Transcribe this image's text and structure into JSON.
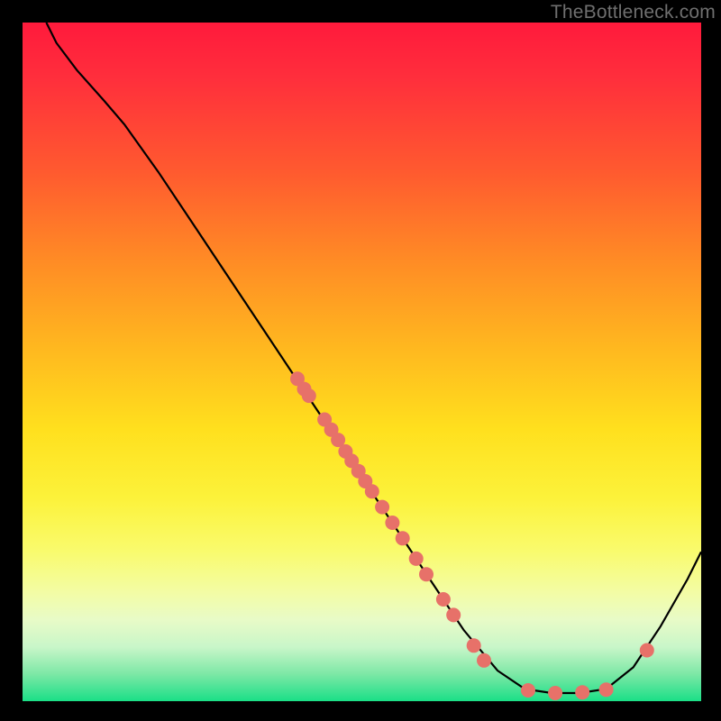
{
  "watermark": "TheBottleneck.com",
  "chart_data": {
    "type": "line",
    "title": "",
    "xlabel": "",
    "ylabel": "",
    "xlim": [
      0,
      100
    ],
    "ylim": [
      0,
      100
    ],
    "curve": [
      {
        "x": 3.5,
        "y": 100
      },
      {
        "x": 5,
        "y": 97
      },
      {
        "x": 8,
        "y": 93
      },
      {
        "x": 12,
        "y": 88.5
      },
      {
        "x": 15,
        "y": 85
      },
      {
        "x": 20,
        "y": 78
      },
      {
        "x": 25,
        "y": 70.5
      },
      {
        "x": 30,
        "y": 63
      },
      {
        "x": 35,
        "y": 55.5
      },
      {
        "x": 40,
        "y": 48
      },
      {
        "x": 45,
        "y": 40.5
      },
      {
        "x": 50,
        "y": 33
      },
      {
        "x": 55,
        "y": 25.5
      },
      {
        "x": 60,
        "y": 18
      },
      {
        "x": 65,
        "y": 10.5
      },
      {
        "x": 70,
        "y": 4.5
      },
      {
        "x": 74,
        "y": 1.8
      },
      {
        "x": 78,
        "y": 1.2
      },
      {
        "x": 82,
        "y": 1.2
      },
      {
        "x": 86,
        "y": 1.8
      },
      {
        "x": 90,
        "y": 5
      },
      {
        "x": 94,
        "y": 11
      },
      {
        "x": 98,
        "y": 18
      },
      {
        "x": 100,
        "y": 22
      }
    ],
    "markers": [
      {
        "x": 40.5,
        "y": 47.5
      },
      {
        "x": 41.5,
        "y": 46
      },
      {
        "x": 42.2,
        "y": 45
      },
      {
        "x": 44.5,
        "y": 41.5
      },
      {
        "x": 45.5,
        "y": 40
      },
      {
        "x": 46.5,
        "y": 38.5
      },
      {
        "x": 47.6,
        "y": 36.8
      },
      {
        "x": 48.5,
        "y": 35.4
      },
      {
        "x": 49.5,
        "y": 33.9
      },
      {
        "x": 50.5,
        "y": 32.4
      },
      {
        "x": 51.5,
        "y": 30.9
      },
      {
        "x": 53,
        "y": 28.6
      },
      {
        "x": 54.5,
        "y": 26.3
      },
      {
        "x": 56,
        "y": 24
      },
      {
        "x": 58,
        "y": 21
      },
      {
        "x": 59.5,
        "y": 18.7
      },
      {
        "x": 62,
        "y": 15
      },
      {
        "x": 63.5,
        "y": 12.7
      },
      {
        "x": 66.5,
        "y": 8.2
      },
      {
        "x": 68,
        "y": 6
      },
      {
        "x": 74.5,
        "y": 1.6
      },
      {
        "x": 78.5,
        "y": 1.2
      },
      {
        "x": 82.5,
        "y": 1.3
      },
      {
        "x": 86,
        "y": 1.7
      },
      {
        "x": 92,
        "y": 7.5
      }
    ],
    "marker_color": "#e77169",
    "curve_color": "#000000",
    "gradient_stops": [
      {
        "pos": 0,
        "color": "#ff1a3c"
      },
      {
        "pos": 100,
        "color": "#1adf87"
      }
    ]
  }
}
